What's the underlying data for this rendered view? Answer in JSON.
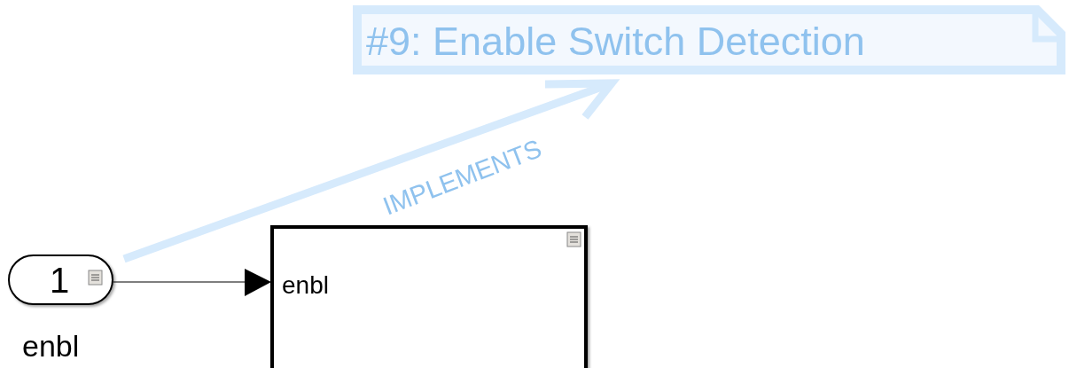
{
  "requirement": {
    "title": "#9: Enable Switch Detection"
  },
  "link": {
    "label": "IMPLEMENTS"
  },
  "inport": {
    "number": "1",
    "name": "enbl"
  },
  "subsystem": {
    "ports": [
      {
        "label": "enbl"
      }
    ]
  }
}
